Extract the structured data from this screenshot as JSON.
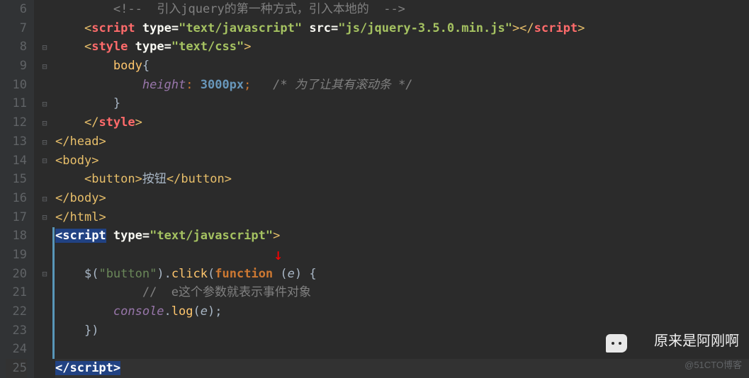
{
  "lines": {
    "start": 6,
    "end": 25
  },
  "code": {
    "l6": {
      "comment_open": "<!--  ",
      "comment_text": "引入jquery的第一种方式，引入本地的",
      "comment_close": "  -->"
    },
    "l7": {
      "tag": "script",
      "attr1": "type",
      "val1": "\"text/javascript\"",
      "attr2": "src",
      "val2": "\"js/jquery-3.5.0.min.js\""
    },
    "l8": {
      "tag": "style",
      "attr": "type",
      "val": "\"text/css\""
    },
    "l9": {
      "selector": "body",
      "brace": "{"
    },
    "l10": {
      "prop": "height",
      "val": "3000px",
      "comment": "/* 为了让其有滚动条 */"
    },
    "l11": {
      "brace": "}"
    },
    "l12": {
      "tag": "style"
    },
    "l13": {
      "tag": "head"
    },
    "l14": {
      "tag": "body"
    },
    "l15": {
      "tag": "button",
      "text": "按钮"
    },
    "l16": {
      "tag": "body"
    },
    "l17": {
      "tag": "html"
    },
    "l18": {
      "tag": "script",
      "attr": "type",
      "val": "\"text/javascript\""
    },
    "l20": {
      "jq": "$",
      "sel": "\"button\"",
      "method": "click",
      "kw": "function",
      "param": "e"
    },
    "l21": {
      "comment": "//  e这个参数就表示事件对象"
    },
    "l22": {
      "obj": "console",
      "method": "log",
      "param": "e"
    },
    "l23": {
      "close": "})"
    },
    "l25": {
      "tag": "script"
    }
  },
  "watermark": {
    "text": "原来是阿刚啊",
    "corner": "@51CTO博客"
  }
}
